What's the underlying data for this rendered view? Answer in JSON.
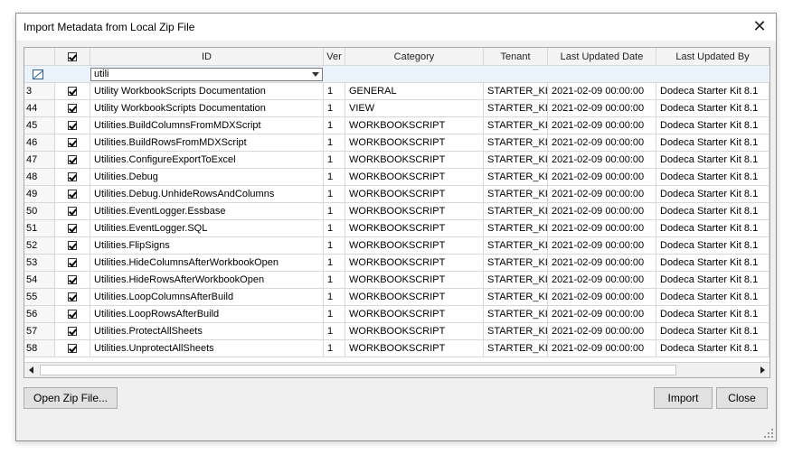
{
  "window": {
    "title": "Import Metadata from Local Zip File",
    "close_glyph": "✕"
  },
  "grid": {
    "columns": [
      "ID",
      "Ver",
      "Category",
      "Tenant",
      "Last Updated Date",
      "Last Updated By"
    ],
    "filter_value": "utili",
    "rows": [
      {
        "num": "3",
        "id": "Utility WorkbookScripts Documentation",
        "ver": "1",
        "category": "GENERAL",
        "tenant": "STARTER_KIT",
        "date": "2021-02-09 00:00:00",
        "by": "Dodeca Starter Kit 8.1"
      },
      {
        "num": "44",
        "id": "Utility WorkbookScripts Documentation",
        "ver": "1",
        "category": "VIEW",
        "tenant": "STARTER_KIT",
        "date": "2021-02-09 00:00:00",
        "by": "Dodeca Starter Kit 8.1"
      },
      {
        "num": "45",
        "id": "Utilities.BuildColumnsFromMDXScript",
        "ver": "1",
        "category": "WORKBOOKSCRIPT",
        "tenant": "STARTER_KIT",
        "date": "2021-02-09 00:00:00",
        "by": "Dodeca Starter Kit 8.1"
      },
      {
        "num": "46",
        "id": "Utilities.BuildRowsFromMDXScript",
        "ver": "1",
        "category": "WORKBOOKSCRIPT",
        "tenant": "STARTER_KIT",
        "date": "2021-02-09 00:00:00",
        "by": "Dodeca Starter Kit 8.1"
      },
      {
        "num": "47",
        "id": "Utilities.ConfigureExportToExcel",
        "ver": "1",
        "category": "WORKBOOKSCRIPT",
        "tenant": "STARTER_KIT",
        "date": "2021-02-09 00:00:00",
        "by": "Dodeca Starter Kit 8.1"
      },
      {
        "num": "48",
        "id": "Utilities.Debug",
        "ver": "1",
        "category": "WORKBOOKSCRIPT",
        "tenant": "STARTER_KIT",
        "date": "2021-02-09 00:00:00",
        "by": "Dodeca Starter Kit 8.1"
      },
      {
        "num": "49",
        "id": "Utilities.Debug.UnhideRowsAndColumns",
        "ver": "1",
        "category": "WORKBOOKSCRIPT",
        "tenant": "STARTER_KIT",
        "date": "2021-02-09 00:00:00",
        "by": "Dodeca Starter Kit 8.1"
      },
      {
        "num": "50",
        "id": "Utilities.EventLogger.Essbase",
        "ver": "1",
        "category": "WORKBOOKSCRIPT",
        "tenant": "STARTER_KIT",
        "date": "2021-02-09 00:00:00",
        "by": "Dodeca Starter Kit 8.1"
      },
      {
        "num": "51",
        "id": "Utilities.EventLogger.SQL",
        "ver": "1",
        "category": "WORKBOOKSCRIPT",
        "tenant": "STARTER_KIT",
        "date": "2021-02-09 00:00:00",
        "by": "Dodeca Starter Kit 8.1"
      },
      {
        "num": "52",
        "id": "Utilities.FlipSigns",
        "ver": "1",
        "category": "WORKBOOKSCRIPT",
        "tenant": "STARTER_KIT",
        "date": "2021-02-09 00:00:00",
        "by": "Dodeca Starter Kit 8.1"
      },
      {
        "num": "53",
        "id": "Utilities.HideColumnsAfterWorkbookOpen",
        "ver": "1",
        "category": "WORKBOOKSCRIPT",
        "tenant": "STARTER_KIT",
        "date": "2021-02-09 00:00:00",
        "by": "Dodeca Starter Kit 8.1"
      },
      {
        "num": "54",
        "id": "Utilities.HideRowsAfterWorkbookOpen",
        "ver": "1",
        "category": "WORKBOOKSCRIPT",
        "tenant": "STARTER_KIT",
        "date": "2021-02-09 00:00:00",
        "by": "Dodeca Starter Kit 8.1"
      },
      {
        "num": "55",
        "id": "Utilities.LoopColumnsAfterBuild",
        "ver": "1",
        "category": "WORKBOOKSCRIPT",
        "tenant": "STARTER_KIT",
        "date": "2021-02-09 00:00:00",
        "by": "Dodeca Starter Kit 8.1"
      },
      {
        "num": "56",
        "id": "Utilities.LoopRowsAfterBuild",
        "ver": "1",
        "category": "WORKBOOKSCRIPT",
        "tenant": "STARTER_KIT",
        "date": "2021-02-09 00:00:00",
        "by": "Dodeca Starter Kit 8.1"
      },
      {
        "num": "57",
        "id": "Utilities.ProtectAllSheets",
        "ver": "1",
        "category": "WORKBOOKSCRIPT",
        "tenant": "STARTER_KIT",
        "date": "2021-02-09 00:00:00",
        "by": "Dodeca Starter Kit 8.1"
      },
      {
        "num": "58",
        "id": "Utilities.UnprotectAllSheets",
        "ver": "1",
        "category": "WORKBOOKSCRIPT",
        "tenant": "STARTER_KIT",
        "date": "2021-02-09 00:00:00",
        "by": "Dodeca Starter Kit 8.1"
      }
    ]
  },
  "buttons": {
    "open_zip": "Open Zip File...",
    "import": "Import",
    "close": "Close"
  }
}
